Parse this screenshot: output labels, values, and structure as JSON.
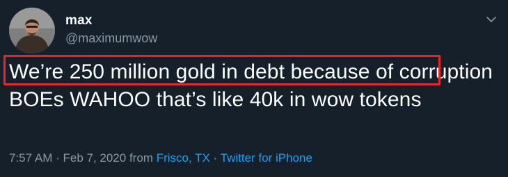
{
  "tweet": {
    "display_name": "max",
    "handle": "@maximumwow",
    "text": "We’re 250 million gold in debt because of corruption BOEs WAHOO that’s like 40k in wow tokens",
    "time": "7:57 AM",
    "sep1": " · ",
    "date": "Feb 7, 2020",
    "from_label": " from ",
    "location": "Frisco, TX",
    "sep2": " · ",
    "source": "Twitter for iPhone"
  },
  "icons": {
    "avatar": "profile-photo",
    "menu": "chevron-down-icon"
  },
  "colors": {
    "background": "#15202b",
    "text_primary": "#ffffff",
    "text_secondary": "#8899a6",
    "link": "#1da1f2",
    "highlight": "#e8252b"
  }
}
